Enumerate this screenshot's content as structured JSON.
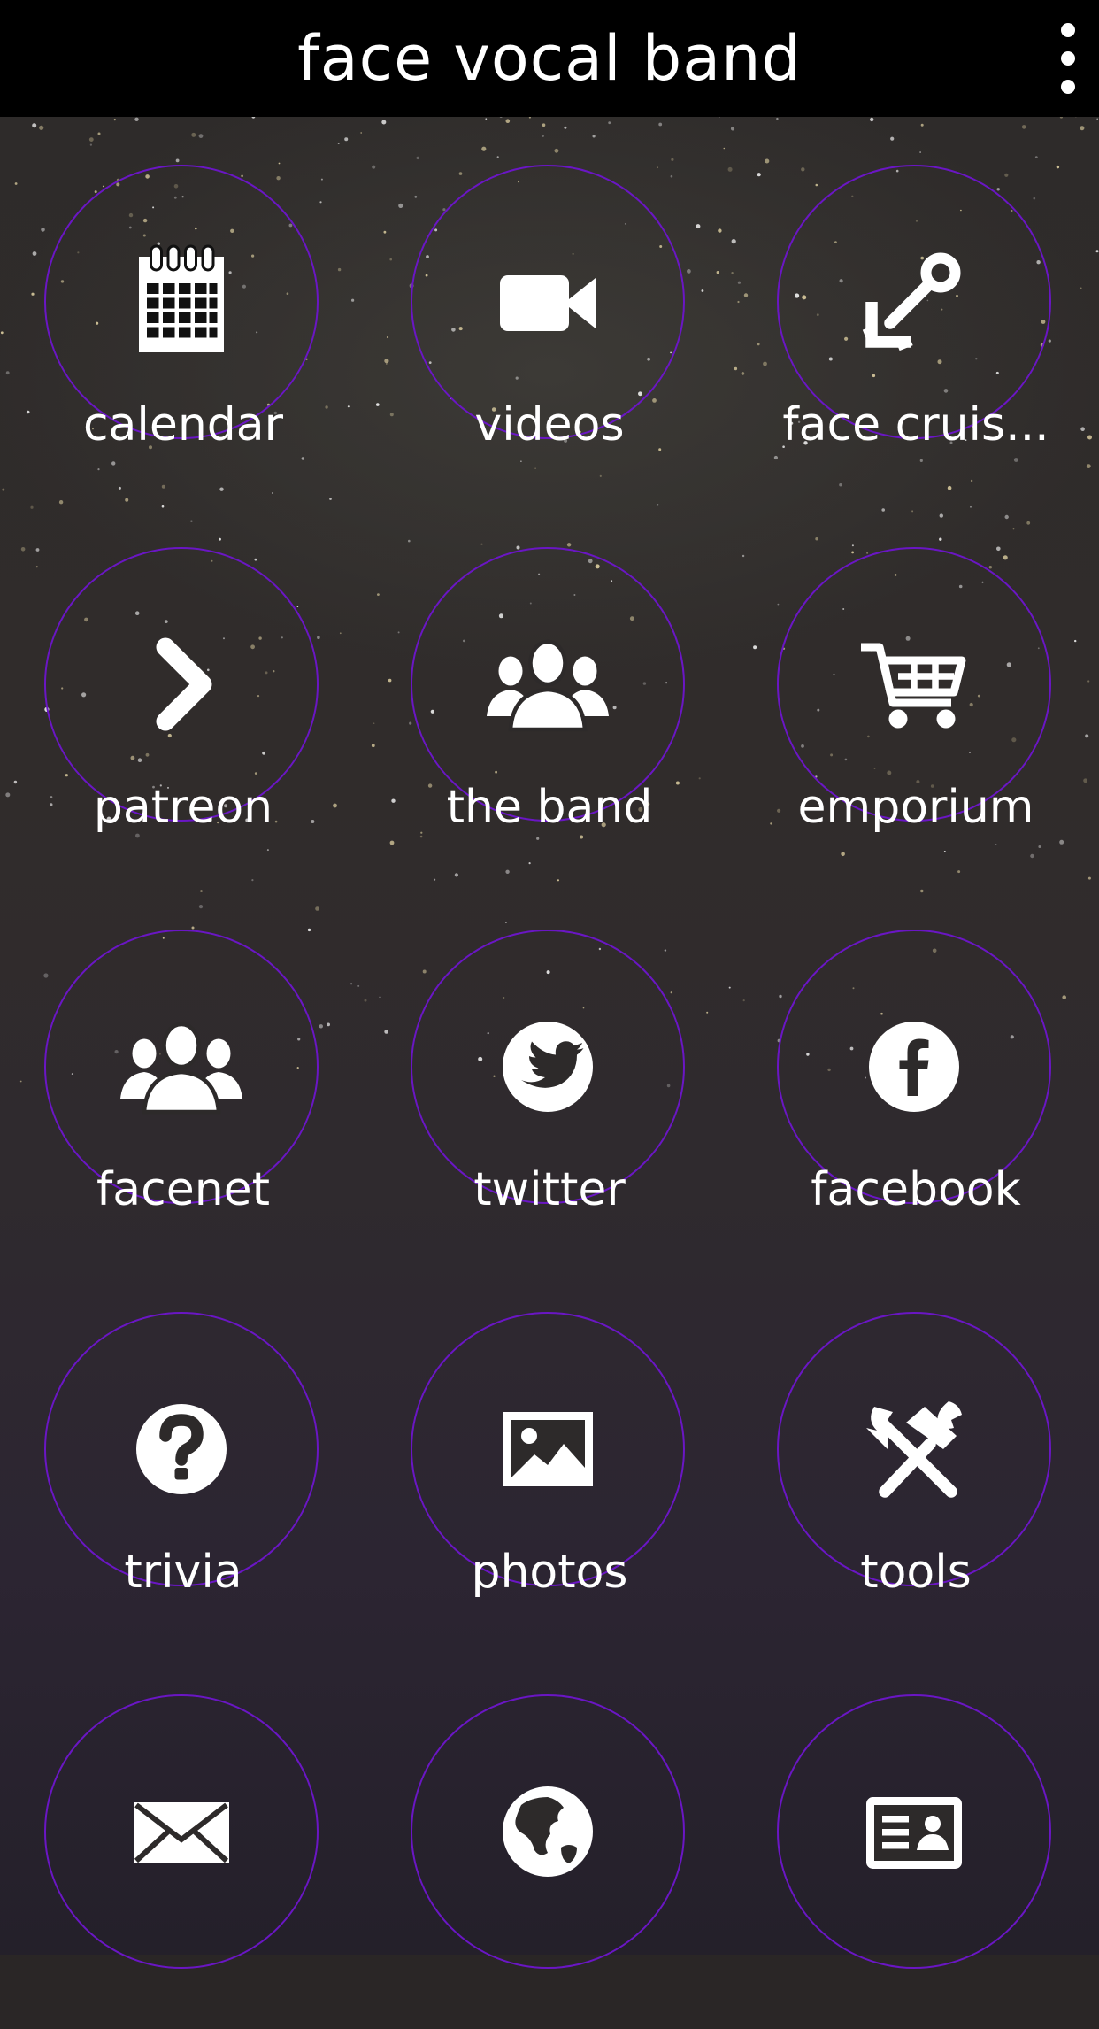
{
  "app": {
    "title": "face vocal band"
  },
  "tiles": [
    {
      "label": "calendar",
      "icon": "calendar-icon"
    },
    {
      "label": "videos",
      "icon": "video-camera-icon"
    },
    {
      "label": "face cruis...",
      "icon": "anchor-icon"
    },
    {
      "label": "patreon",
      "icon": "chevron-right-icon"
    },
    {
      "label": "the band",
      "icon": "people-group-icon"
    },
    {
      "label": "emporium",
      "icon": "shopping-cart-icon"
    },
    {
      "label": "facenet",
      "icon": "people-group-icon"
    },
    {
      "label": "twitter",
      "icon": "twitter-icon"
    },
    {
      "label": "facebook",
      "icon": "facebook-icon"
    },
    {
      "label": "trivia",
      "icon": "question-circle-icon"
    },
    {
      "label": "photos",
      "icon": "image-icon"
    },
    {
      "label": "tools",
      "icon": "hammer-wrench-icon"
    },
    {
      "label": "",
      "icon": "envelope-icon"
    },
    {
      "label": "",
      "icon": "globe-icon"
    },
    {
      "label": "",
      "icon": "contact-card-icon"
    }
  ],
  "colors": {
    "accent": "#6a16c4",
    "header": "#000000"
  }
}
